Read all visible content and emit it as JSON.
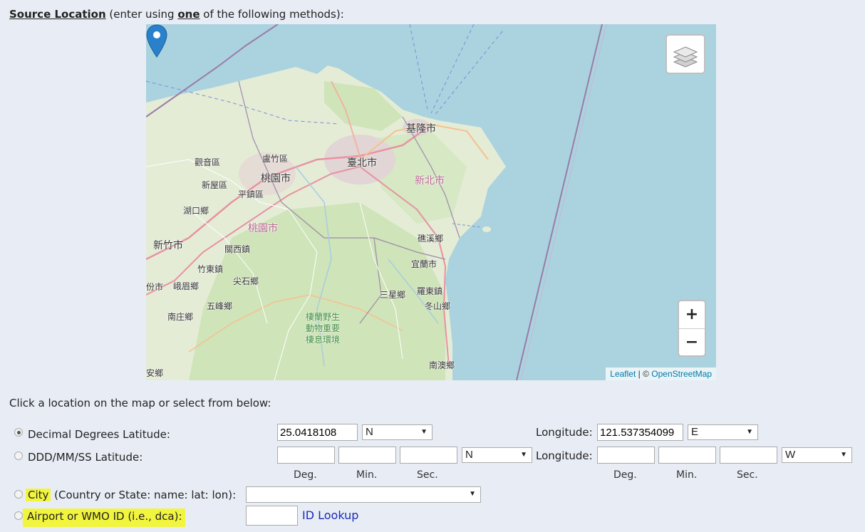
{
  "heading": {
    "title": "Source Location",
    "pre": " (enter using ",
    "emphasis": "one",
    "post": " of the following methods):"
  },
  "map": {
    "labels": {
      "keelung": "基隆市",
      "taipei": "臺北市",
      "new_taipei": "新北市",
      "guanyin": "觀音區",
      "luzhu": "盧竹區",
      "taoyuan_city": "桃園市",
      "xinwu": "新屋區",
      "pingzhen": "平鎮區",
      "hukou": "湖口鄉",
      "taoyuan_county": "桃園市",
      "hsinchu": "新竹市",
      "guanxi": "關西鎮",
      "zhudong": "竹東鎮",
      "jianshi": "尖石鄉",
      "miaoli_edge": "份市",
      "emei": "峨眉鄉",
      "wufeng": "五峰鄉",
      "nanzhuang": "南庄鄉",
      "jiaoxi": "礁溪鄉",
      "yilan": "宜蘭市",
      "sanxing": "三星鄉",
      "luodong": "羅東鎮",
      "dongshan": "冬山鄉",
      "wildlife": "棲蘭野生",
      "wildlife2": "動物重要",
      "wildlife3": "棲息環境",
      "nanao": "南澳鄉",
      "anxiang": "安鄉"
    },
    "zoom_in": "+",
    "zoom_out": "−",
    "attribution": {
      "leaflet": "Leaflet",
      "sep": " | © ",
      "osm": "OpenStreetMap"
    }
  },
  "instruction": "Click a location on the map or select from below:",
  "decimal": {
    "label": "Decimal Degrees Latitude:",
    "lat_value": "25.0418108",
    "lat_dir": "N",
    "lon_label": "Longitude:",
    "lon_value": "121.537354099",
    "lon_dir": "E"
  },
  "dms": {
    "label": "DDD/MM/SS Latitude:",
    "lat_dir": "N",
    "lon_label": "Longitude:",
    "lon_dir": "W",
    "deg": "Deg.",
    "min": "Min.",
    "sec": "Sec."
  },
  "city": {
    "word": "City",
    "rest": " (Country or State: name: lat: lon):"
  },
  "airport": {
    "label": "Airport or WMO ID (i.e., dca):",
    "link": "ID Lookup"
  },
  "colors": {
    "highlight": "#f2f53d",
    "sea": "#aad3df",
    "land": "#e4ecd6",
    "pin": "#2a81cb"
  }
}
